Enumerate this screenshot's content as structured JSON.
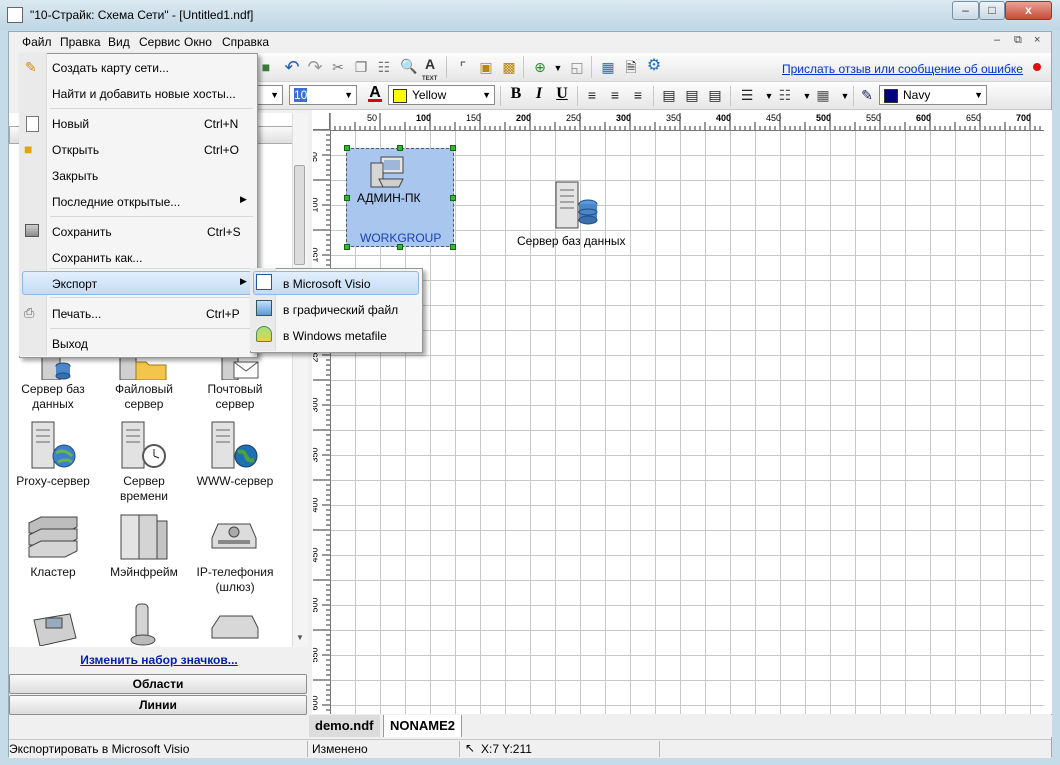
{
  "window": {
    "title": "\"10-Страйк: Схема Сети\" - [Untitled1.ndf]",
    "min_glyph": "–",
    "max_glyph": "□",
    "close_glyph": "x"
  },
  "menubar": {
    "items": [
      "Файл",
      "Правка",
      "Вид",
      "Сервис",
      "Окно",
      "Справка"
    ],
    "mdi_min": "–",
    "mdi_restore": "⧉",
    "mdi_close": "×"
  },
  "toolbar": {
    "feedback_link": "Прислать отзыв или сообщение об ошибке",
    "icons": [
      "open-folder-icon",
      "undo-icon",
      "redo-icon",
      "cut-icon",
      "copy-icon",
      "paste-icon",
      "find-icon",
      "text-icon",
      "connector-icon",
      "lock-icon",
      "group-icon",
      "zoom-in-icon",
      "zoom-fit-icon",
      "image-icon",
      "print-preview-icon",
      "settings-icon"
    ],
    "text_label": "TEXT"
  },
  "format_bar": {
    "font_size": "10",
    "fill_color_name": "Yellow",
    "fill_color_hex": "#ffff00",
    "line_color_name": "Navy",
    "line_color_hex": "#000080",
    "bold": "B",
    "italic": "I",
    "underline": "U",
    "font_color_letter": "A"
  },
  "file_menu": {
    "items": [
      {
        "label": "Создать карту сети...",
        "shortcut": ""
      },
      {
        "label": "Найти и добавить новые хосты...",
        "shortcut": ""
      },
      {
        "label": "Новый",
        "shortcut": "Ctrl+N"
      },
      {
        "label": "Открыть",
        "shortcut": "Ctrl+O"
      },
      {
        "label": "Закрыть",
        "shortcut": ""
      },
      {
        "label": "Последние открытые...",
        "shortcut": ""
      },
      {
        "label": "Сохранить",
        "shortcut": "Ctrl+S"
      },
      {
        "label": "Сохранить как...",
        "shortcut": ""
      },
      {
        "label": "Экспорт",
        "shortcut": ""
      },
      {
        "label": "Печать...",
        "shortcut": "Ctrl+P"
      },
      {
        "label": "Выход",
        "shortcut": ""
      }
    ]
  },
  "export_submenu": {
    "items": [
      "в Microsoft Visio",
      "в графический файл",
      "в Windows metafile"
    ]
  },
  "palette": {
    "items": [
      {
        "label": "Сервер баз данных"
      },
      {
        "label": "Файловый сервер"
      },
      {
        "label": "Почтовый сервер"
      },
      {
        "label": "Proxy-сервер"
      },
      {
        "label": "Сервер времени"
      },
      {
        "label": "WWW-сервер"
      },
      {
        "label": "Кластер"
      },
      {
        "label": "Мэйнфрейм"
      },
      {
        "label": "IP-телефония (шлюз)"
      }
    ],
    "change_link": "Изменить набор значков...",
    "areas_button": "Области",
    "lines_button": "Линии"
  },
  "canvas": {
    "ruler_top": [
      "50",
      "100",
      "150",
      "200",
      "250",
      "300",
      "350",
      "400",
      "450",
      "500",
      "550",
      "600",
      "650",
      "700"
    ],
    "ruler_left": [
      "50",
      "100",
      "150",
      "200",
      "250",
      "300",
      "350",
      "400",
      "450",
      "500",
      "550",
      "600"
    ],
    "nodes": [
      {
        "label": "АДМИН-ПК",
        "group": "WORKGROUP",
        "fill": "#a8c6ee"
      },
      {
        "label": "Сервер баз данных"
      }
    ]
  },
  "tabs": [
    "demo.ndf",
    "NONAME2"
  ],
  "status": {
    "hint": "Экспортировать в Microsoft Visio",
    "state": "Изменено",
    "coords": "X:7  Y:211"
  }
}
